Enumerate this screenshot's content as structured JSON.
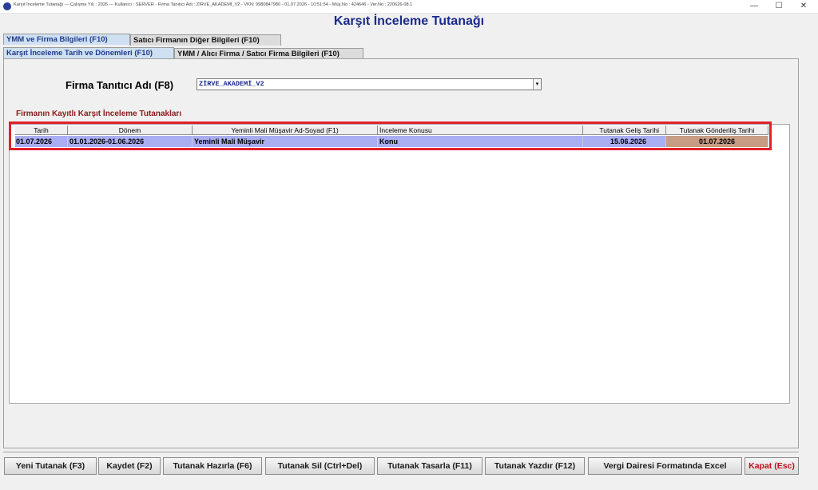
{
  "window": {
    "title_bar_text": "Karşıt İnceleme Tutanağı  ---  Çalışma Yılı : 2026  ---  Kullanıcı : SERVER - Firma Tanıtıcı Adı : ZİRVE_AKADEMİ_V2 - VKN: 9980847980 - 01.07.2026 - 10:51:54 - Müş.No : 424646 - Ver.No : 220626-08.1",
    "minimize_glyph": "—",
    "maximize_glyph": "☐",
    "close_glyph": "✕"
  },
  "page_title": "Karşıt İnceleme Tutanağı",
  "tabs_row1": [
    {
      "label": "YMM ve Firma Bilgileri (F10)",
      "active": true
    },
    {
      "label": "Satıcı Firmanın Diğer Bilgileri (F10)",
      "active": false
    }
  ],
  "tabs_row2": [
    {
      "label": "Karşıt İnceleme Tarih ve Dönemleri (F10)",
      "active": true
    },
    {
      "label": "YMM / Alıcı Firma / Satıcı Firma Bilgileri (F10)",
      "active": false
    }
  ],
  "firma": {
    "label": "Firma Tanıtıcı Adı (F8)",
    "value": "ZİRVE_AKADEMİ_V2"
  },
  "section_title": "Firmanın Kayıtlı Karşıt İnceleme Tutanakları",
  "table": {
    "columns": [
      "Tarih",
      "Dönem",
      "Yeminli Mali Müşavir Ad-Soyad (F1)",
      "İnceleme Konusu",
      "Tutanak Geliş Tarihi",
      "Tutanak Gönderiliş Tarihi"
    ],
    "rows": [
      {
        "tarih": "01.07.2026",
        "donem": "01.01.2026-01.06.2026",
        "ymm": "Yeminli Mali Müşavir",
        "konu": "Konu",
        "gelis": "15.06.2026",
        "gonderilis": "01.07.2026"
      }
    ]
  },
  "buttons": {
    "yeni": "Yeni Tutanak (F3)",
    "kaydet": "Kaydet (F2)",
    "hazirla": "Tutanak Hazırla (F6)",
    "sil": "Tutanak Sil (Ctrl+Del)",
    "tasarla": "Tutanak Tasarla (F11)",
    "yazdir": "Tutanak Yazdır (F12)",
    "excel": "Vergi Dairesi Formatında Excel",
    "kapat": "Kapat (Esc)"
  },
  "colors": {
    "title_blue": "#1a2a8c",
    "section_red": "#8b1a1a",
    "row_selected": "#a9aef3",
    "row_highlight_brown": "#c79c82",
    "outline_red": "#e0202a"
  }
}
